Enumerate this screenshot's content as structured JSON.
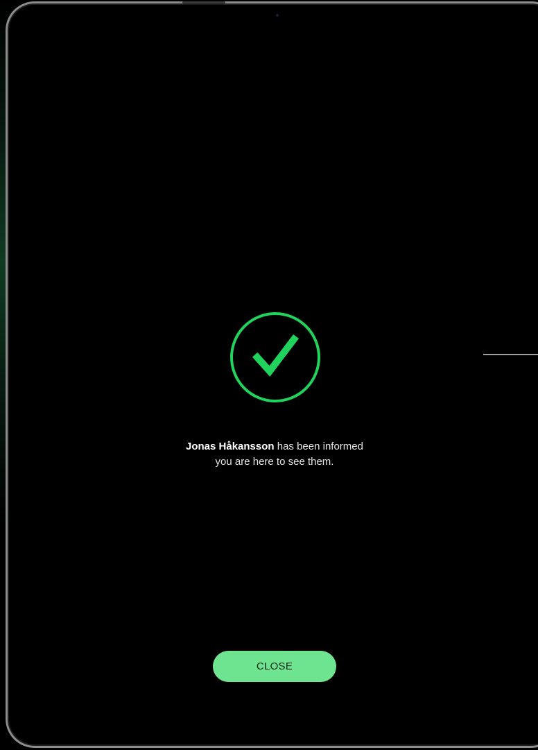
{
  "confirmation": {
    "icon": "checkmark-circle-icon",
    "name": "Jonas Håkansson",
    "message_line1_rest": " has been informed",
    "message_line2": "you are here to see them."
  },
  "actions": {
    "close_label": "CLOSE"
  },
  "colors": {
    "accent": "#1fd35c",
    "button": "#6ee491",
    "background": "#000000"
  }
}
